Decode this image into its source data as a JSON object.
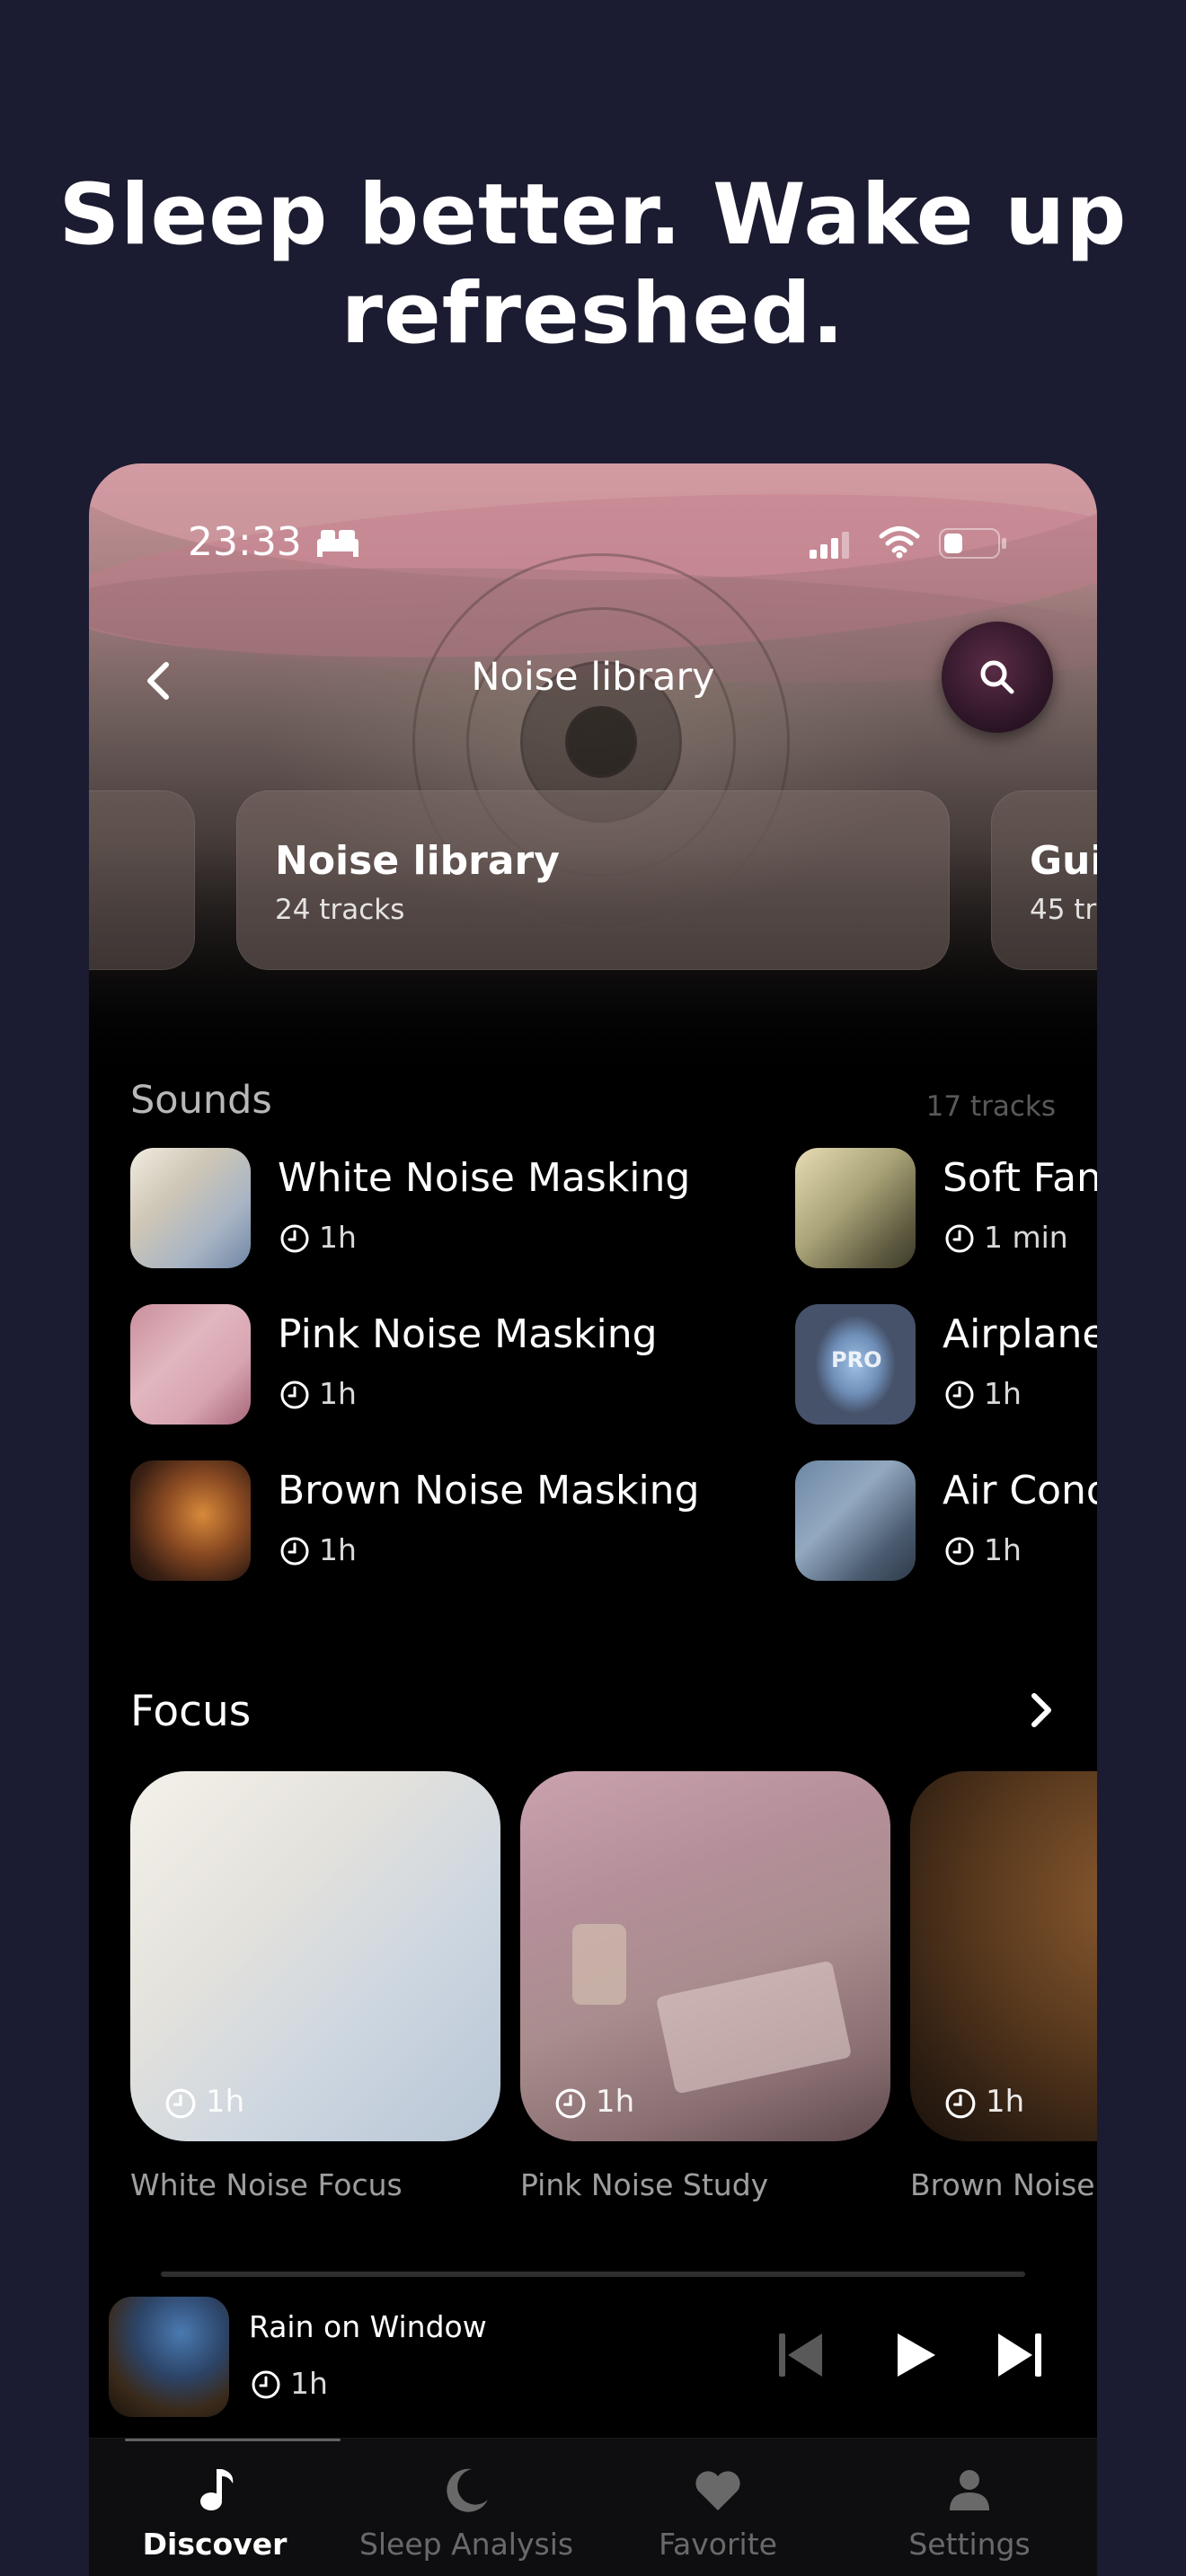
{
  "headline": "Sleep better. Wake up refreshed.",
  "status_bar": {
    "time": "23:33"
  },
  "header": {
    "title": "Noise library"
  },
  "category_cards": [
    {
      "title": "Noise library",
      "subtitle": "24 tracks"
    },
    {
      "title": "Gui",
      "subtitle": "45 tr"
    }
  ],
  "sounds": {
    "title": "Sounds",
    "count": "17 tracks",
    "tracks": [
      {
        "name": "White Noise Masking",
        "duration": "1h"
      },
      {
        "name": "Pink Noise Masking",
        "duration": "1h"
      },
      {
        "name": "Brown Noise Masking",
        "duration": "1h"
      },
      {
        "name": "Soft Fan",
        "duration": "1 min"
      },
      {
        "name": "Airplane",
        "duration": "1h",
        "badge": "PRO"
      },
      {
        "name": "Air Cond",
        "duration": "1h"
      }
    ]
  },
  "focus": {
    "title": "Focus",
    "cards": [
      {
        "label": "White Noise Focus",
        "duration": "1h"
      },
      {
        "label": "Pink Noise Study",
        "duration": "1h"
      },
      {
        "label": "Brown Noise Fo",
        "duration": "1h"
      }
    ]
  },
  "player": {
    "title": "Rain on Window",
    "duration": "1h",
    "progress": 0
  },
  "tabs": [
    {
      "label": "Discover",
      "icon": "music-note-icon",
      "active": true
    },
    {
      "label": "Sleep Analysis",
      "icon": "moon-icon",
      "active": false
    },
    {
      "label": "Favorite",
      "icon": "heart-icon",
      "active": false
    },
    {
      "label": "Settings",
      "icon": "person-icon",
      "active": false
    }
  ],
  "colors": {
    "background": "#1b1b31",
    "accent": "#5a2c46"
  }
}
